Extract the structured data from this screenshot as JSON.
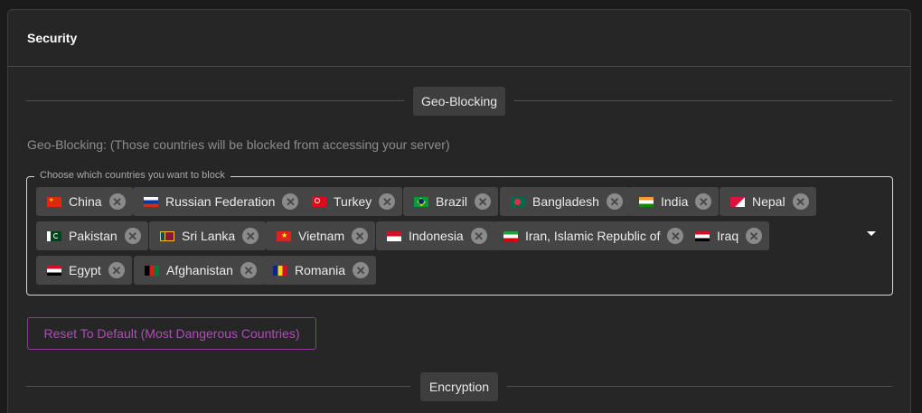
{
  "card": {
    "title": "Security"
  },
  "geo": {
    "section_label": "Geo-Blocking",
    "description": "Geo-Blocking: (Those countries will be blocked from accessing your server)",
    "select_label": "Choose which countries you want to block",
    "countries": [
      {
        "name": "China",
        "flag": "cn"
      },
      {
        "name": "Russian Federation",
        "flag": "ru"
      },
      {
        "name": "Turkey",
        "flag": "tr"
      },
      {
        "name": "Brazil",
        "flag": "br"
      },
      {
        "name": "Bangladesh",
        "flag": "bd"
      },
      {
        "name": "India",
        "flag": "in"
      },
      {
        "name": "Nepal",
        "flag": "np"
      },
      {
        "name": "Pakistan",
        "flag": "pk"
      },
      {
        "name": "Sri Lanka",
        "flag": "lk"
      },
      {
        "name": "Vietnam",
        "flag": "vn"
      },
      {
        "name": "Indonesia",
        "flag": "id"
      },
      {
        "name": "Iran, Islamic Republic of",
        "flag": "ir"
      },
      {
        "name": "Iraq",
        "flag": "iq"
      },
      {
        "name": "Egypt",
        "flag": "eg"
      },
      {
        "name": "Afghanistan",
        "flag": "af"
      },
      {
        "name": "Romania",
        "flag": "ro"
      }
    ],
    "remove_icon": "cancel-circle-icon",
    "dropdown_icon": "caret-down-icon",
    "reset_label": "Reset To Default (Most Dangerous Countries)"
  },
  "encryption": {
    "section_label": "Encryption"
  },
  "colors": {
    "accent": "#b04bbb",
    "chip_bg": "#454545",
    "card_bg": "#262626"
  }
}
